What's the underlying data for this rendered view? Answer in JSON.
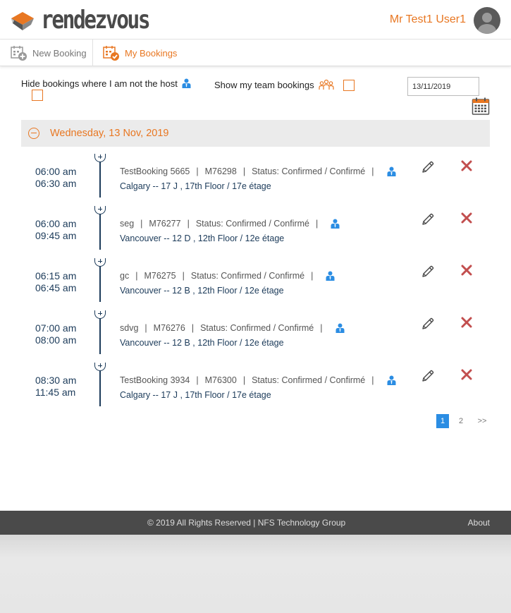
{
  "app": {
    "name": "rendezvous",
    "brand_color": "#e87722",
    "text_color": "#1c3b5a",
    "accent_blue": "#2b8de3"
  },
  "header": {
    "user_name": "Mr Test1 User1"
  },
  "nav": {
    "new_booking": "New Booking",
    "my_bookings": "My Bookings"
  },
  "filters": {
    "hide_not_host_label": "Hide bookings where I am not the host",
    "team_label": "Show my team bookings",
    "date_value": "13/11/2019"
  },
  "day": {
    "label": "Wednesday, 13 Nov, 2019"
  },
  "bookings": [
    {
      "start": "06:00 am",
      "end": "06:30 am",
      "title": "TestBooking 5665",
      "code": "M76298",
      "status": "Status: Confirmed / Confirmé",
      "location": "Calgary -- 17 J , 17th Floor / 17e étage"
    },
    {
      "start": "06:00 am",
      "end": "09:45 am",
      "title": "seg",
      "code": "M76277",
      "status": "Status: Confirmed / Confirmé",
      "location": "Vancouver -- 12 D , 12th Floor / 12e étage"
    },
    {
      "start": "06:15 am",
      "end": "06:45 am",
      "title": "gc",
      "code": "M76275",
      "status": "Status: Confirmed / Confirmé",
      "location": "Vancouver -- 12 B , 12th Floor / 12e étage"
    },
    {
      "start": "07:00 am",
      "end": "08:00 am",
      "title": "sdvg",
      "code": "M76276",
      "status": "Status: Confirmed / Confirmé",
      "location": "Vancouver -- 12 B , 12th Floor / 12e étage"
    },
    {
      "start": "08:30 am",
      "end": "11:45 am",
      "title": "TestBooking 3934",
      "code": "M76300",
      "status": "Status: Confirmed / Confirmé",
      "location": "Calgary -- 17 J , 17th Floor / 17e étage"
    }
  ],
  "separator": "|",
  "pagination": {
    "pages": [
      "1",
      "2"
    ],
    "current": "1",
    "next": ">>"
  },
  "footer": {
    "copyright": "© 2019 All Rights Reserved | NFS Technology Group",
    "about": "About"
  }
}
